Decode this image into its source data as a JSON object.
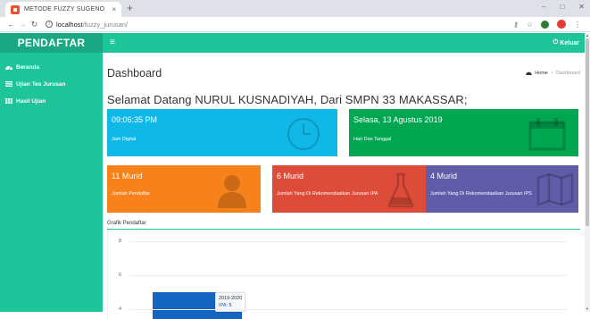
{
  "browser": {
    "tab_title": "METODE FUZZY SUGENO",
    "tab_close": "×",
    "new_tab": "+",
    "url_host": "localhost",
    "url_path": "/fuzzy_jurusan/",
    "window_controls": [
      "–",
      "□",
      "✕"
    ]
  },
  "app": {
    "brand": "PENDAFTAR",
    "logout_label": "Keluar",
    "accent_color": "#1ec59a"
  },
  "sidebar": {
    "items": [
      {
        "label": "Beranda",
        "icon": "dashboard-icon"
      },
      {
        "label": "Ujian Tes Jurusan",
        "icon": "list-icon"
      },
      {
        "label": "Hasil Ujian",
        "icon": "table-icon"
      }
    ]
  },
  "header": {
    "title": "Dashboard",
    "breadcrumb_home": "Home",
    "breadcrumb_current": "Dashboard"
  },
  "welcome": "Selamat Datang NURUL KUSNADIYAH, Dari SMPN 33 MAKASSAR;",
  "boxes": {
    "clock": {
      "value": "09:06:35 PM",
      "label": "Jam Digital",
      "color": "#10b8e8"
    },
    "date": {
      "value": "Selasa, 13 Agustus 2019",
      "label": "Hari Dan Tanggal",
      "color": "#00a650"
    },
    "pendaftar": {
      "value": "11 Murid",
      "label": "Jumlah Pendaftar",
      "color": "#f7821b"
    },
    "ipa": {
      "value": "6 Murid",
      "label": "Jumlah Yang Di Rekomendasikan Jurusan IPA",
      "color": "#dd4c39"
    },
    "ips": {
      "value": "4 Murid",
      "label": "Jumlah Yang Di Rekomendasikan Jurusan IPS",
      "color": "#615ca8"
    }
  },
  "chart": {
    "title": "Grafik Pendaftar",
    "tooltip_category": "2019-2020",
    "tooltip_series": "IPA",
    "tooltip_value": "5"
  },
  "chart_data": {
    "type": "bar",
    "title": "Grafik Pendaftar",
    "y_ticks": [
      8,
      6,
      4
    ],
    "categories": [
      "2019-2020"
    ],
    "series": [
      {
        "name": "IPA",
        "values": [
          5
        ],
        "color": "#1565c0"
      }
    ]
  }
}
